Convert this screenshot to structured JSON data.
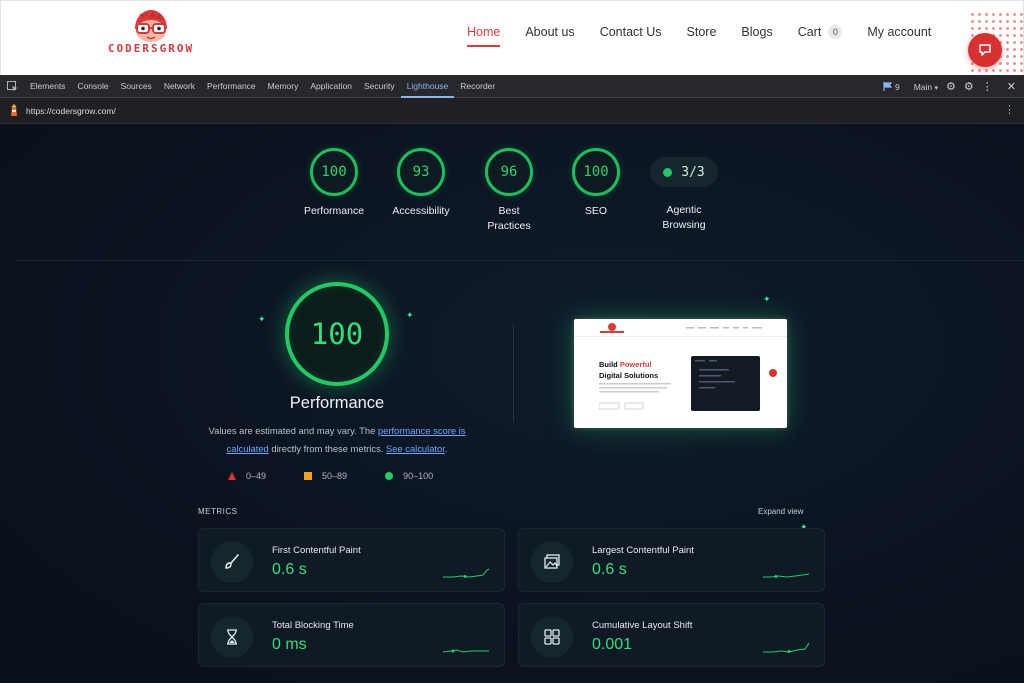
{
  "site": {
    "logo_text": "CODERSGROW",
    "nav": [
      {
        "label": "Home",
        "active": true
      },
      {
        "label": "About us"
      },
      {
        "label": "Contact Us"
      },
      {
        "label": "Store"
      },
      {
        "label": "Blogs"
      },
      {
        "label": "Cart",
        "badge": "0"
      },
      {
        "label": "My account"
      }
    ],
    "accent_color": "#e03b3b"
  },
  "devtools": {
    "tabs": [
      "Elements",
      "Console",
      "Sources",
      "Network",
      "Performance",
      "Memory",
      "Application",
      "Security",
      "Lighthouse",
      "Recorder"
    ],
    "active_tab": "Lighthouse",
    "issues_count": "9",
    "target": "Main",
    "url": "https://codersgrow.com/"
  },
  "scores": [
    {
      "value": "100",
      "label": "Performance"
    },
    {
      "value": "93",
      "label": "Accessibility"
    },
    {
      "value": "96",
      "label": "Best Practices"
    },
    {
      "value": "100",
      "label": "SEO"
    },
    {
      "value": "3/3",
      "label": "Agentic Browsing"
    }
  ],
  "performance": {
    "score": "100",
    "title": "Performance",
    "desc_1": "Values are estimated and may vary. The ",
    "desc_link_1": "performance score is calculated",
    "desc_2": " directly from these metrics. ",
    "desc_link_2": "See calculator",
    "desc_3": ".",
    "legend": [
      {
        "range": "0–49",
        "color": "#e0322d",
        "shape": "triangle"
      },
      {
        "range": "50–89",
        "color": "#f0a21a",
        "shape": "square"
      },
      {
        "range": "90–100",
        "color": "#1fcf63",
        "shape": "circle"
      }
    ]
  },
  "preview": {
    "headline_1": "Build ",
    "headline_hl": "Powerful",
    "headline_2": "Digital Solutions"
  },
  "metrics": {
    "section_label": "METRICS",
    "expand_label": "Expand view",
    "items": [
      {
        "name": "First Contentful Paint",
        "value": "0.6 s",
        "icon": "brush-icon"
      },
      {
        "name": "Largest Contentful Paint",
        "value": "0.6 s",
        "icon": "image-icon"
      },
      {
        "name": "Total Blocking Time",
        "value": "0 ms",
        "icon": "hourglass-icon"
      },
      {
        "name": "Cumulative Layout Shift",
        "value": "0.001",
        "icon": "layout-icon"
      }
    ]
  },
  "colors": {
    "good": "#1fcf63",
    "devtools_bg": "#27282b",
    "report_bg": "#0b1320"
  }
}
